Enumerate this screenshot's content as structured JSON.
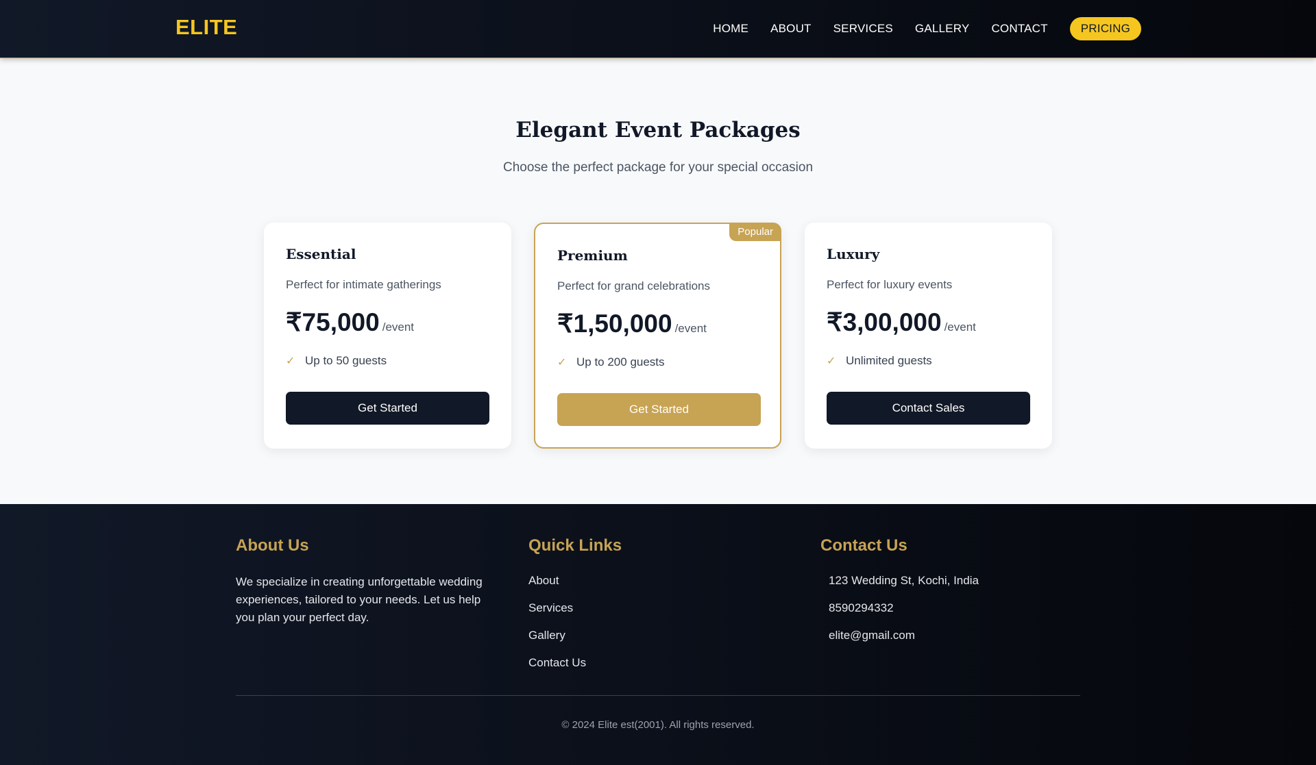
{
  "brand": {
    "logo": "ELITE"
  },
  "nav": {
    "items": [
      "HOME",
      "ABOUT",
      "SERVICES",
      "GALLERY",
      "CONTACT"
    ],
    "active": "PRICING"
  },
  "section": {
    "title": "Elegant Event Packages",
    "subtitle": "Choose the perfect package for your special occasion"
  },
  "packages": [
    {
      "name": "Essential",
      "desc": "Perfect for intimate gatherings",
      "price": "₹75,000",
      "per": "/event",
      "feature": "Up to 50 guests",
      "cta": "Get Started"
    },
    {
      "name": "Premium",
      "desc": "Perfect for grand celebrations",
      "price": "₹1,50,000",
      "per": "/event",
      "feature": "Up to 200 guests",
      "cta": "Get Started",
      "badge": "Popular"
    },
    {
      "name": "Luxury",
      "desc": "Perfect for luxury events",
      "price": "₹3,00,000",
      "per": "/event",
      "feature": "Unlimited guests",
      "cta": "Contact Sales"
    }
  ],
  "footer": {
    "about": {
      "heading": "About Us",
      "text": "We specialize in creating unforgettable wedding experiences, tailored to your needs. Let us help you plan your perfect day."
    },
    "links": {
      "heading": "Quick Links",
      "items": [
        "About",
        "Services",
        "Gallery",
        "Contact Us"
      ]
    },
    "contact": {
      "heading": "Contact Us",
      "address": "123 Wedding St, Kochi, India",
      "phone": "8590294332",
      "email": "elite@gmail.com"
    },
    "copyright": "© 2024 Elite est(2001). All rights reserved."
  },
  "colors": {
    "gold": "#c7a354",
    "yellow": "#f5c61f",
    "navy": "#111827"
  }
}
